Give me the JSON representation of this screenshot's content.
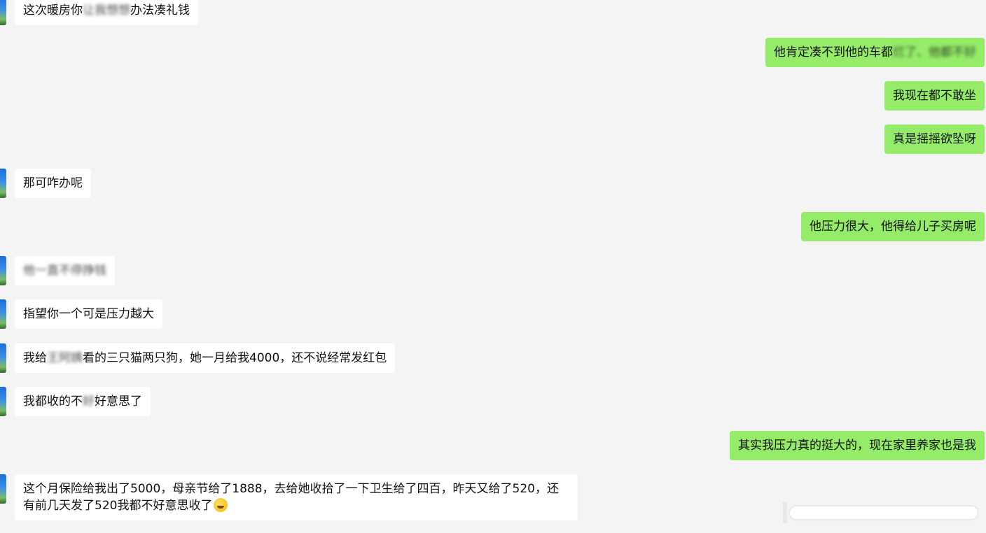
{
  "messages": [
    {
      "side": "left",
      "text_a": "这次暖房你",
      "blur": "让我想想",
      "text_b": "办法凑礼钱"
    },
    {
      "side": "right",
      "text_a": "他肯定凑不到他的车都",
      "blur": "烂了、他都",
      "text_b": "不好"
    },
    {
      "side": "right",
      "text": "我现在都不敢坐"
    },
    {
      "side": "right",
      "text": "真是摇摇欲坠呀"
    },
    {
      "side": "left",
      "text": "那可咋办呢"
    },
    {
      "side": "right",
      "text": "他压力很大，他得给儿子买房呢"
    },
    {
      "side": "left",
      "blur": "他一直不停挣钱"
    },
    {
      "side": "left",
      "text": "指望你一个可是压力越大"
    },
    {
      "side": "left",
      "text_a": "我给",
      "blur": "王阿姨",
      "text_b": "看的三只猫两只狗，她一月给我4000，还不说经常发红包"
    },
    {
      "side": "left",
      "text_a": "我都收的不",
      "blur": "好",
      "text_b": "好意思了"
    },
    {
      "side": "right",
      "text": "其实我压力真的挺大的，现在家里养家也是我"
    },
    {
      "side": "left",
      "text": "这个月保险给我出了5000，母亲节给了1888，去给她收拾了一下卫生给了四百，昨天又给了520，还有前几天发了520我都不好意思收了",
      "emoji": "laugh-cry-emoji"
    }
  ],
  "colors": {
    "self_bubble": "#95ec69",
    "other_bubble": "#ffffff",
    "background": "#f4f4f4"
  }
}
